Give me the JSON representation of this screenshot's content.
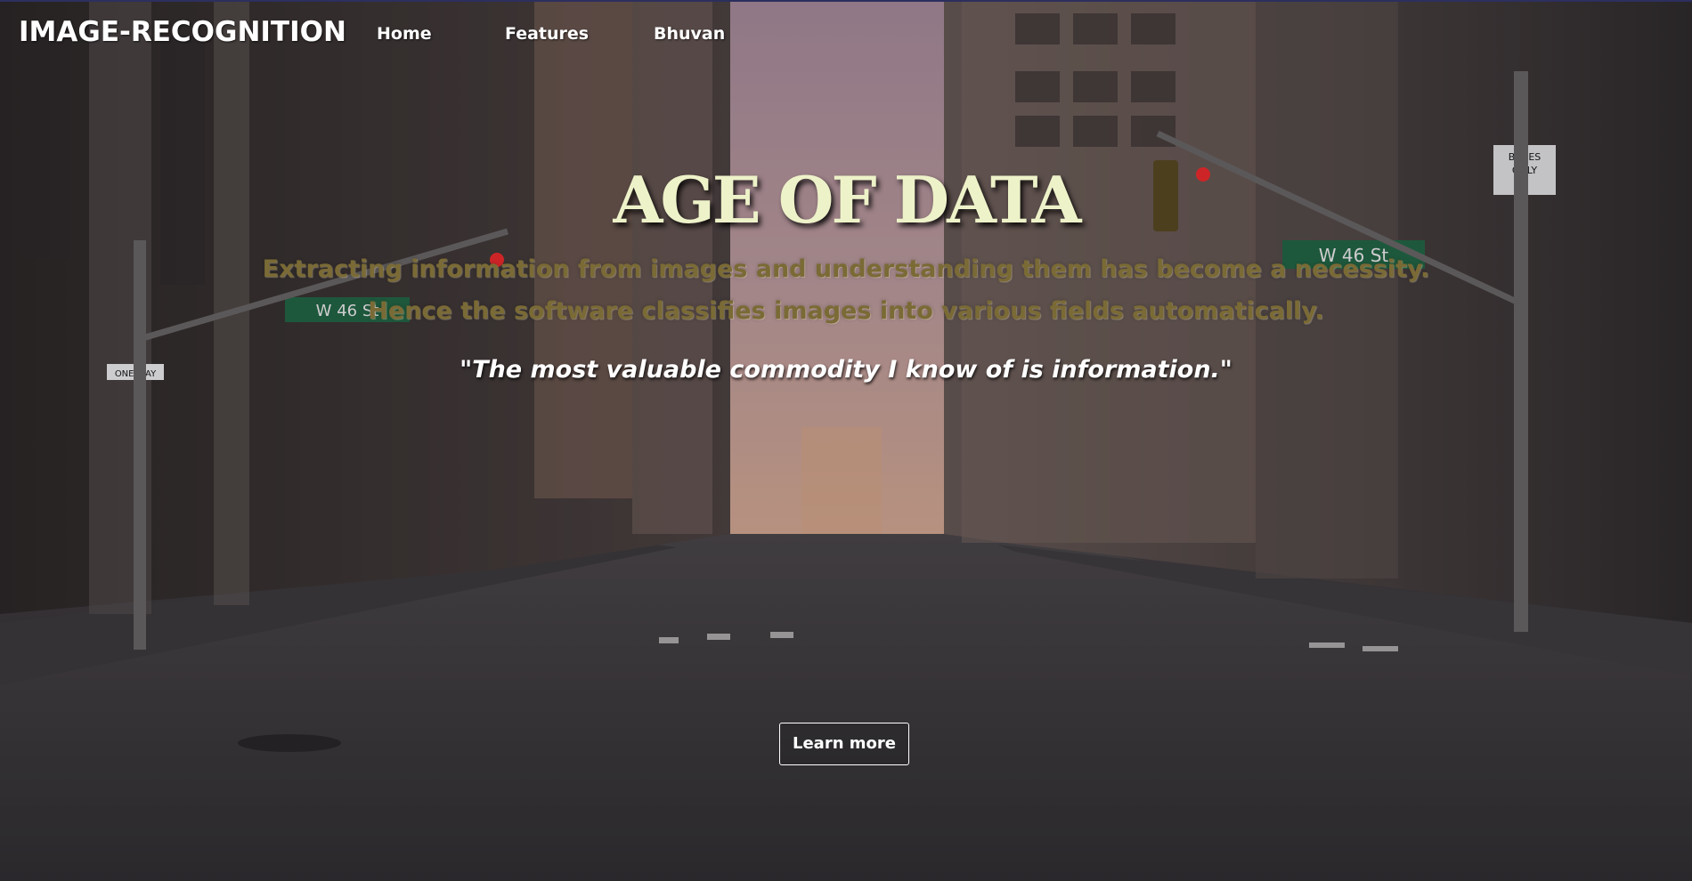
{
  "navbar": {
    "brand": "IMAGE-RECOGNITION",
    "links": [
      {
        "label": "Home"
      },
      {
        "label": "Features"
      },
      {
        "label": "Bhuvan"
      }
    ]
  },
  "hero": {
    "title": "AGE OF DATA",
    "subtitle_line1": "Extracting information from images and understanding them has become a necessity.",
    "subtitle_line2": "Hence the software classifies images into various fields automatically.",
    "quote": "\"The most valuable commodity I know of is information.\"",
    "cta_label": "Learn more"
  },
  "background": {
    "street_signs": [
      "W 46 St",
      "W 46 St",
      "ONE WAY",
      "BUSES ONLY"
    ],
    "colors": {
      "sky": "#b89aa6",
      "street": "#3e3c3d",
      "title": "#eef2c9",
      "subtitle": "#7a6a35",
      "nav_border": "#2c2f5e"
    }
  }
}
